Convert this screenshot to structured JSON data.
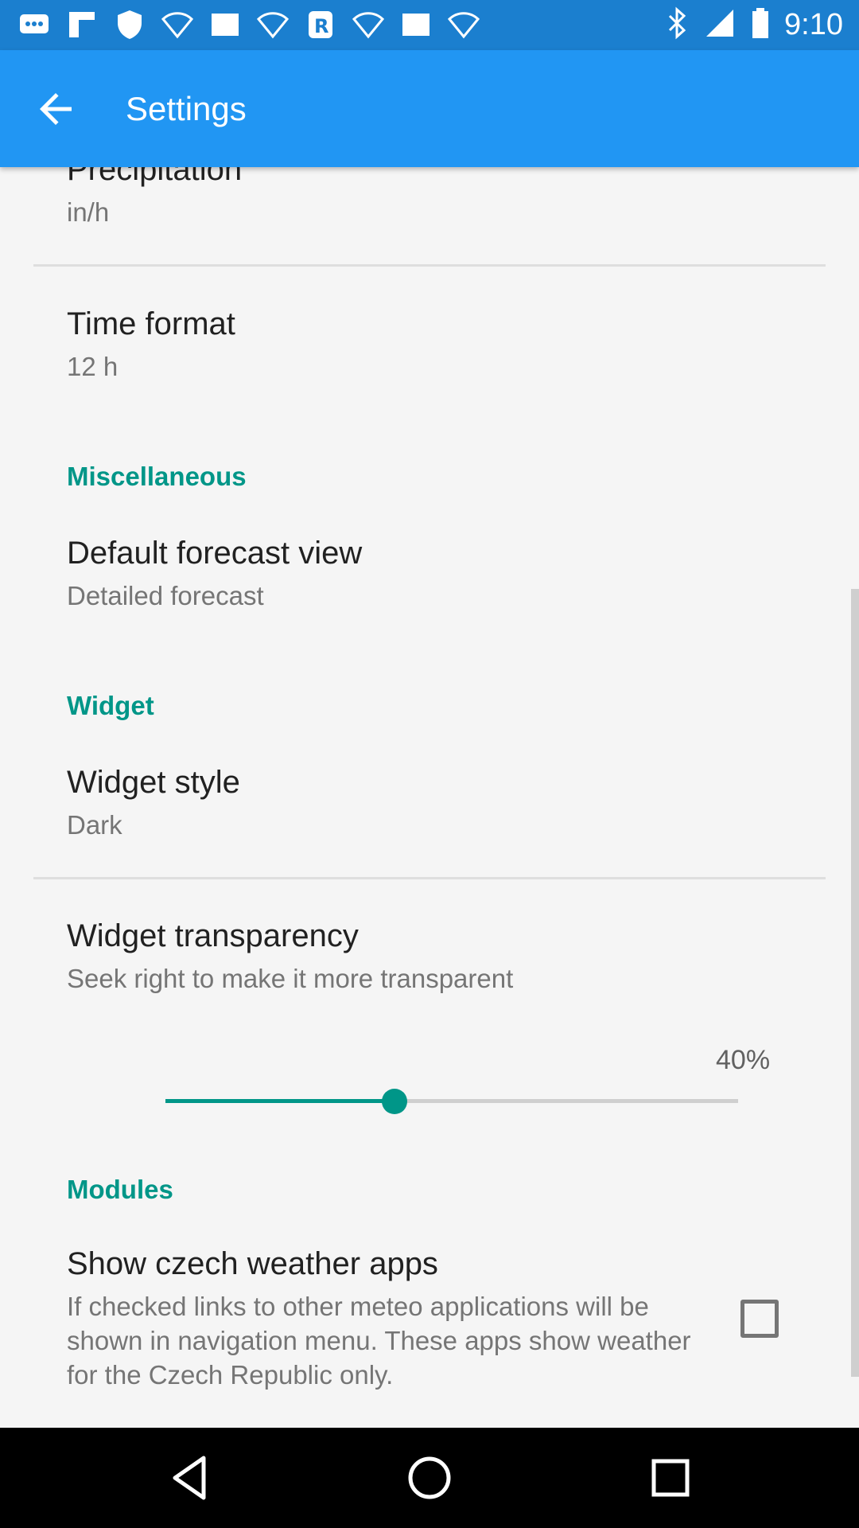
{
  "status_bar": {
    "time": "9:10",
    "notification_icons": [
      "chat-icon",
      "flipboard-icon",
      "shield-icon",
      "wifi-icon",
      "image-icon",
      "wifi-icon",
      "r-app-icon",
      "wifi-icon",
      "image-icon",
      "wifi-icon"
    ],
    "system_icons": [
      "bluetooth-icon",
      "signal-icon",
      "battery-icon"
    ]
  },
  "app_bar": {
    "title": "Settings",
    "back_icon": "arrow-back-icon"
  },
  "preferences": {
    "precipitation": {
      "title": "Precipitation",
      "summary": "in/h"
    },
    "time_format": {
      "title": "Time format",
      "summary": "12 h"
    },
    "misc_category": "Miscellaneous",
    "default_forecast": {
      "title": "Default forecast view",
      "summary": "Detailed forecast"
    },
    "widget_category": "Widget",
    "widget_style": {
      "title": "Widget style",
      "summary": "Dark"
    },
    "widget_transparency": {
      "title": "Widget transparency",
      "summary": "Seek right to make it more transparent",
      "value_text": "40%",
      "value": 0.4
    },
    "modules_category": "Modules",
    "czech_apps": {
      "title": "Show czech weather apps",
      "summary": "If checked links to other meteo applications will be shown in navigation menu. These apps show weather for the Czech Republic only.",
      "checked": false
    }
  },
  "colors": {
    "primary": "#2196f3",
    "status": "#1b7fcf",
    "accent": "#009688"
  }
}
